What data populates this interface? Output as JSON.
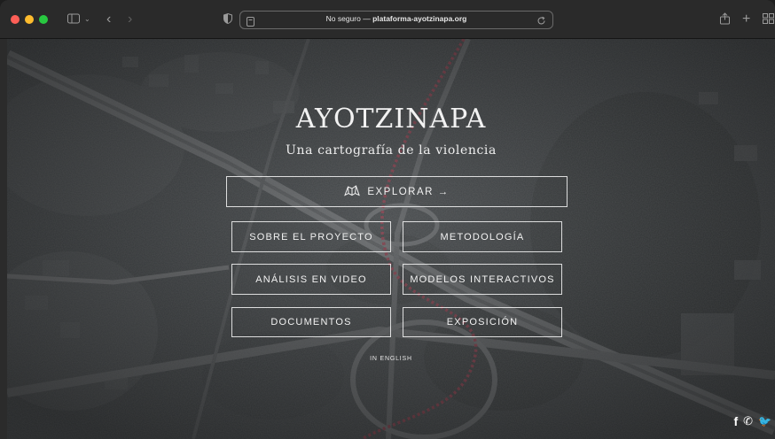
{
  "browser": {
    "url_prefix": "No seguro —",
    "url_domain": "plataforma-ayotzinapa.org"
  },
  "hero": {
    "title": "AYOTZINAPA",
    "subtitle": "Una cartografía de la violencia"
  },
  "explore": {
    "label": "EXPLORAR →"
  },
  "menu": [
    {
      "label": "SOBRE EL PROYECTO"
    },
    {
      "label": "METODOLOGÍA"
    },
    {
      "label": "ANÁLISIS EN VIDEO"
    },
    {
      "label": "MODELOS INTERACTIVOS"
    },
    {
      "label": "DOCUMENTOS"
    },
    {
      "label": "EXPOSICIÓN"
    }
  ],
  "language_link": "IN ENGLISH",
  "social": {
    "facebook": "f",
    "whatsapp": "✆",
    "twitter": "🐦"
  }
}
